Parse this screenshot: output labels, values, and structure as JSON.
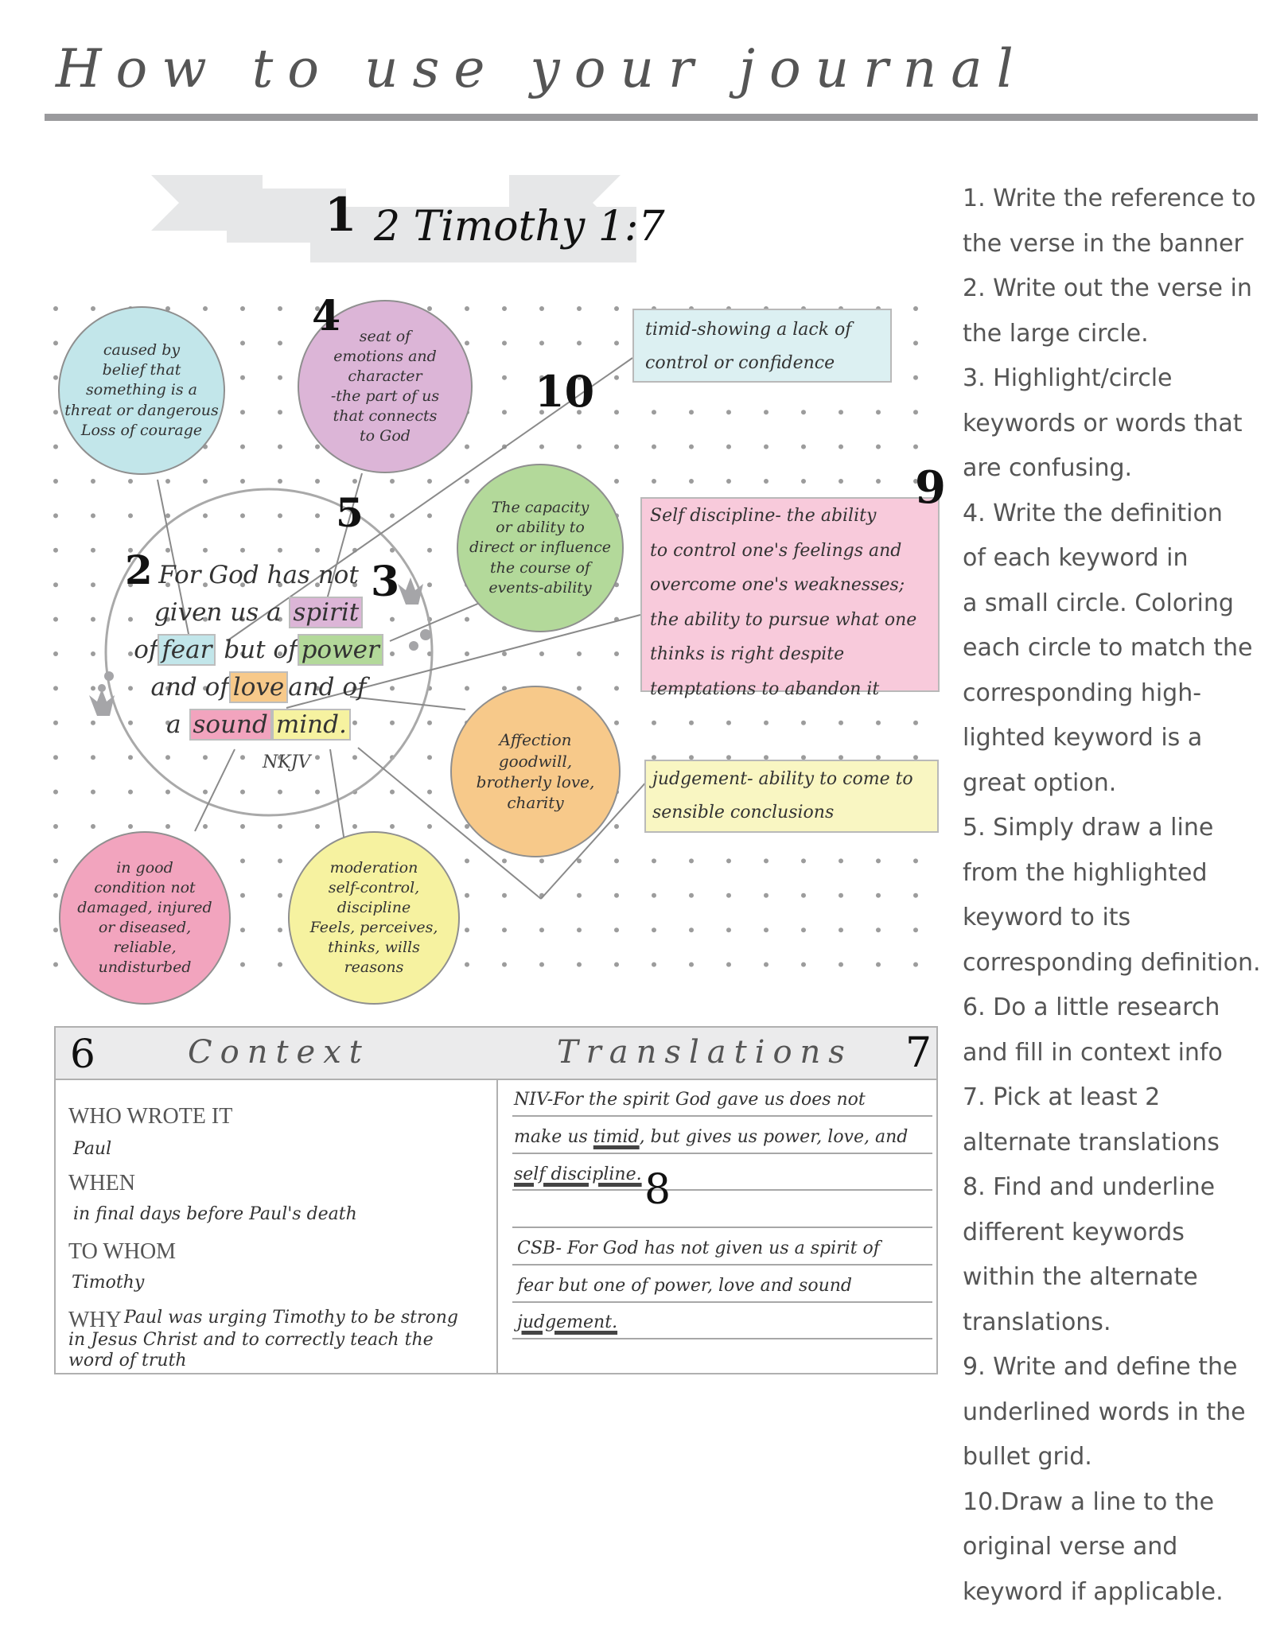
{
  "page": {
    "title": "How to use your journal"
  },
  "banner": {
    "step_number": "1",
    "reference": "2 Timothy 1:7"
  },
  "step_markers": {
    "s2": "2",
    "s3": "3",
    "s4": "4",
    "s5": "5",
    "s6": "6",
    "s7": "7",
    "s8": "8",
    "s9": "9",
    "s10": "10"
  },
  "verse": {
    "line1": "For God has not",
    "line2_pre": "given us a",
    "kw_spirit": "spirit",
    "line3_pre": "of",
    "kw_fear": "fear",
    "line3_mid": "but of",
    "kw_power": "power",
    "line4_pre": "and of",
    "kw_love": "love",
    "line4_post": "and of",
    "line5_pre": "a",
    "kw_sound": "sound",
    "kw_mind": "mind.",
    "version": "NKJV"
  },
  "keyword_colors": {
    "fear": "#c2e6ea",
    "spirit": "#dcb5d7",
    "power": "#b3d99a",
    "love": "#f7c98a",
    "sound": "#f2a4be",
    "mind": "#f6f2a0"
  },
  "definitions": {
    "fear": "caused by\nbelief that\nsomething is a\nthreat or dangerous\nLoss of courage",
    "spirit": "seat of\nemotions and\ncharacter\n-the part of us\nthat connects\nto God",
    "power": "The capacity\nor ability to\ndirect or influence\nthe course of\nevents-ability",
    "love": "Affection\ngoodwill,\nbrotherly love,\ncharity",
    "sound": "in good\ncondition not\ndamaged, injured\nor diseased,\nreliable,\nundisturbed",
    "mind": "moderation\nself-control,\ndiscipline\nFeels, perceives,\nthinks, wills\nreasons"
  },
  "underlined_definitions": {
    "timid": "timid-showing a lack of\ncontrol or confidence",
    "self_discipline": "Self discipline- the ability\nto control one's feelings and\novercome one's weaknesses;\nthe ability to pursue what one\nthinks is right despite\ntemptations to abandon it",
    "judgement": "judgement- ability to come to\nsensible conclusions"
  },
  "context": {
    "heading": "Context",
    "who_label": "WHO WROTE IT",
    "who_value": "Paul",
    "when_label": "WHEN",
    "when_value": "in final days before Paul's death",
    "to_whom_label": "TO WHOM",
    "to_whom_value": "Timothy",
    "why_label": "WHY",
    "why_value_line1": "Paul was urging Timothy to be strong",
    "why_value_line2": "in Jesus Christ and to correctly teach the",
    "why_value_line3": "word of truth"
  },
  "translations": {
    "heading": "Translations",
    "niv_line1": "NIV-For the spirit God gave us does not",
    "niv_line2_pre": "make us ",
    "niv_line2_kw": "timid",
    "niv_line2_post": ", but gives us power, love, and",
    "niv_line3_kw": "self discipline.",
    "csb_line1": "CSB- For God has not given us a spirit of",
    "csb_line2": "fear but one of power, love and sound",
    "csb_line3_kw": "judgement."
  },
  "instructions": {
    "text": "1. Write the reference to\nthe verse in the banner\n2. Write out the verse in\nthe large circle.\n3. Highlight/circle\nkeywords or words that\nare confusing.\n4. Write the definition\nof each keyword in\na small circle.  Coloring\neach circle to match the\ncorresponding high-\nlighted keyword is a\ngreat option.\n5. Simply draw a line\nfrom the highlighted\nkeyword to its\ncorresponding definition.\n6.  Do a little research\nand fill in context info\n7. Pick at least 2\nalternate translations\n8.  Find and underline\ndifferent keywords\nwithin the alternate\ntranslations.\n9. Write and define the\nunderlined words in the\nbullet grid.\n10.Draw a line to the\noriginal verse and\nkeyword if applicable."
  }
}
